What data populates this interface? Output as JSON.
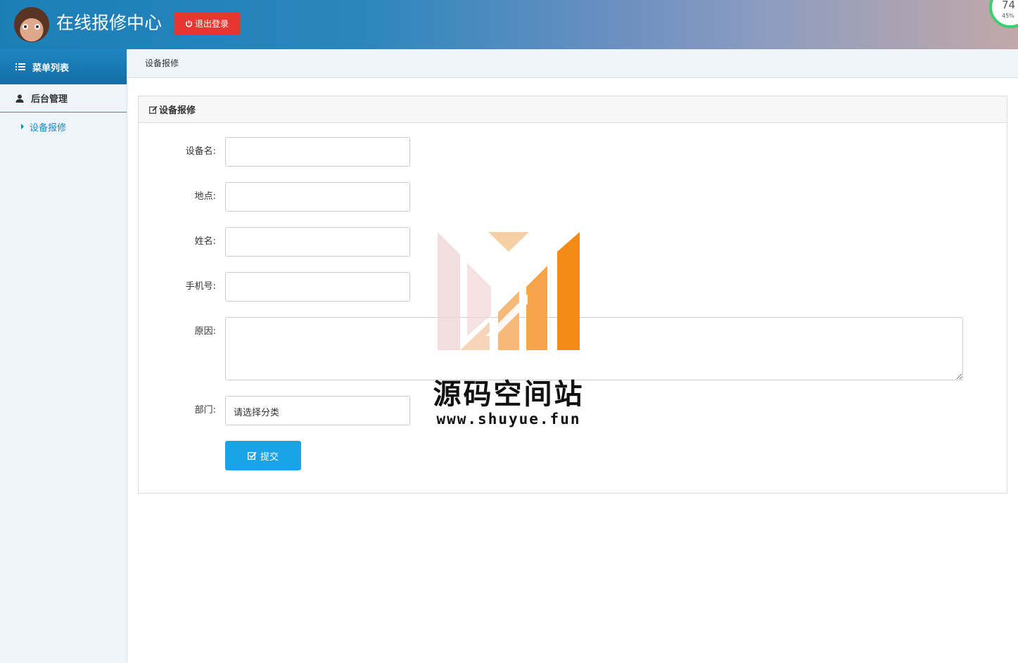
{
  "header": {
    "title": "在线报修中心",
    "logout_label": "退出登录",
    "badge_number": "74",
    "badge_percent": "45%"
  },
  "sidebar": {
    "heading": "菜单列表",
    "group_label": "后台管理",
    "items": [
      {
        "label": "设备报修"
      }
    ]
  },
  "breadcrumb": "设备报修",
  "panel": {
    "title": "设备报修"
  },
  "form": {
    "device_label": "设备名:",
    "location_label": "地点:",
    "name_label": "姓名:",
    "phone_label": "手机号:",
    "reason_label": "原因:",
    "department_label": "部门:",
    "department_selected": "请选择分类",
    "submit_label": "提交"
  },
  "watermark": {
    "brand": "源码空间站",
    "url": "www.shuyue.fun"
  },
  "colors": {
    "primary": "#1aa2e6",
    "danger": "#e73530",
    "sidebar_accent": "#1a8bc6"
  }
}
